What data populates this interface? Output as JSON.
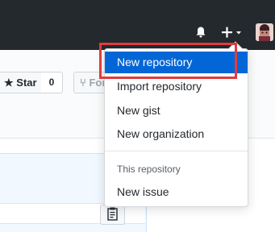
{
  "header": {
    "notifications_icon": "bell-icon",
    "create_icon": "plus-icon",
    "create_caret_icon": "caret-down-icon"
  },
  "repo_actions": {
    "star_label": "Star",
    "star_count": "0",
    "fork_label": "Fork"
  },
  "create_menu": {
    "items": [
      {
        "label": "New repository",
        "active": true
      },
      {
        "label": "Import repository"
      },
      {
        "label": "New gist"
      },
      {
        "label": "New organization"
      }
    ],
    "section_header": "This repository",
    "section_items": [
      {
        "label": "New issue"
      }
    ]
  },
  "colors": {
    "header_bg": "#24292e",
    "active_item_bg": "#0366d6",
    "highlight_border": "#e03c3c"
  }
}
